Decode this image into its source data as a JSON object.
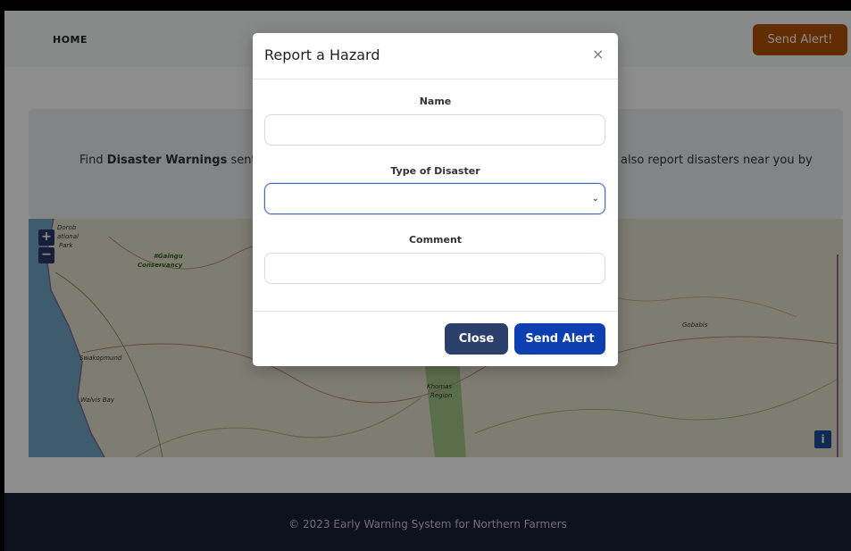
{
  "navbar": {
    "home_label": "HOME",
    "send_alert_label": "Send Alert!"
  },
  "intro": {
    "left_pre": "Find ",
    "left_bold": "Disaster Warnings",
    "left_post": " sent by c",
    "right_text": "also report disasters near you by"
  },
  "map": {
    "zoom_in": "+",
    "zoom_out": "−",
    "info": "i",
    "labels": {
      "dorob1": "Dorob",
      "dorob2": "ational",
      "dorob3": "Park",
      "gaingu1": "#Gaingu",
      "gaingu2": "Conservancy",
      "swakopmund": "Swakopmund",
      "walvis": "Walvis Bay",
      "khomas1": "Khomas",
      "khomas2": "Region",
      "gobabis": "Gobabis"
    }
  },
  "modal": {
    "title": "Report a Hazard",
    "close_icon": "×",
    "name_label": "Name",
    "name_value": "",
    "type_label": "Type of Disaster",
    "type_value": "",
    "comment_label": "Comment",
    "comment_value": "",
    "close_button": "Close",
    "send_button": "Send Alert"
  },
  "footer": {
    "text": "© 2023 Early Warning System for Northern Farmers"
  },
  "colors": {
    "accent_orange": "#b45309",
    "primary_blue": "#0d3fb0",
    "close_navy": "#2b3f6b",
    "footer_bg": "#1a2238"
  }
}
